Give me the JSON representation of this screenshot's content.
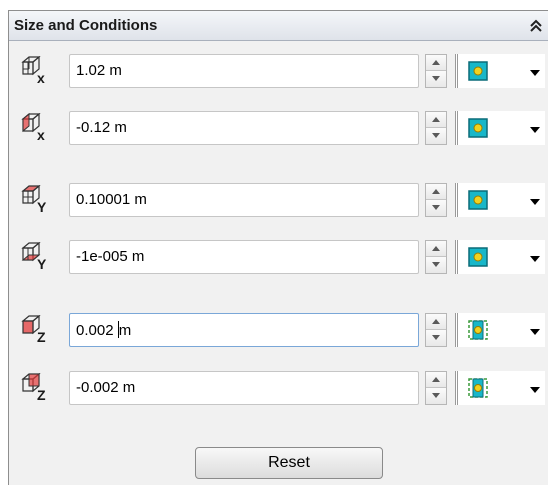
{
  "panel": {
    "title": "Size and Conditions",
    "reset_label": "Reset"
  },
  "rows": [
    {
      "axis": "x",
      "value": "1.02 m",
      "icon": "box-x-positive-icon",
      "condition": "fixed"
    },
    {
      "axis": "x",
      "value": "-0.12 m",
      "icon": "box-x-negative-icon",
      "condition": "fixed"
    },
    {
      "axis": "Y",
      "value": "0.10001 m",
      "icon": "box-y-positive-icon",
      "condition": "fixed"
    },
    {
      "axis": "Y",
      "value": "-1e-005 m",
      "icon": "box-y-negative-icon",
      "condition": "fixed"
    },
    {
      "axis": "Z",
      "value": "0.002 m",
      "icon": "box-z-positive-icon",
      "condition": "dashed"
    },
    {
      "axis": "Z",
      "value": "-0.002 m",
      "icon": "box-z-negative-icon",
      "condition": "dashed"
    }
  ],
  "colors": {
    "condition_fill": "#18b7c9",
    "condition_dot": "#f2d21f",
    "face_highlight": "#e23a3a"
  }
}
